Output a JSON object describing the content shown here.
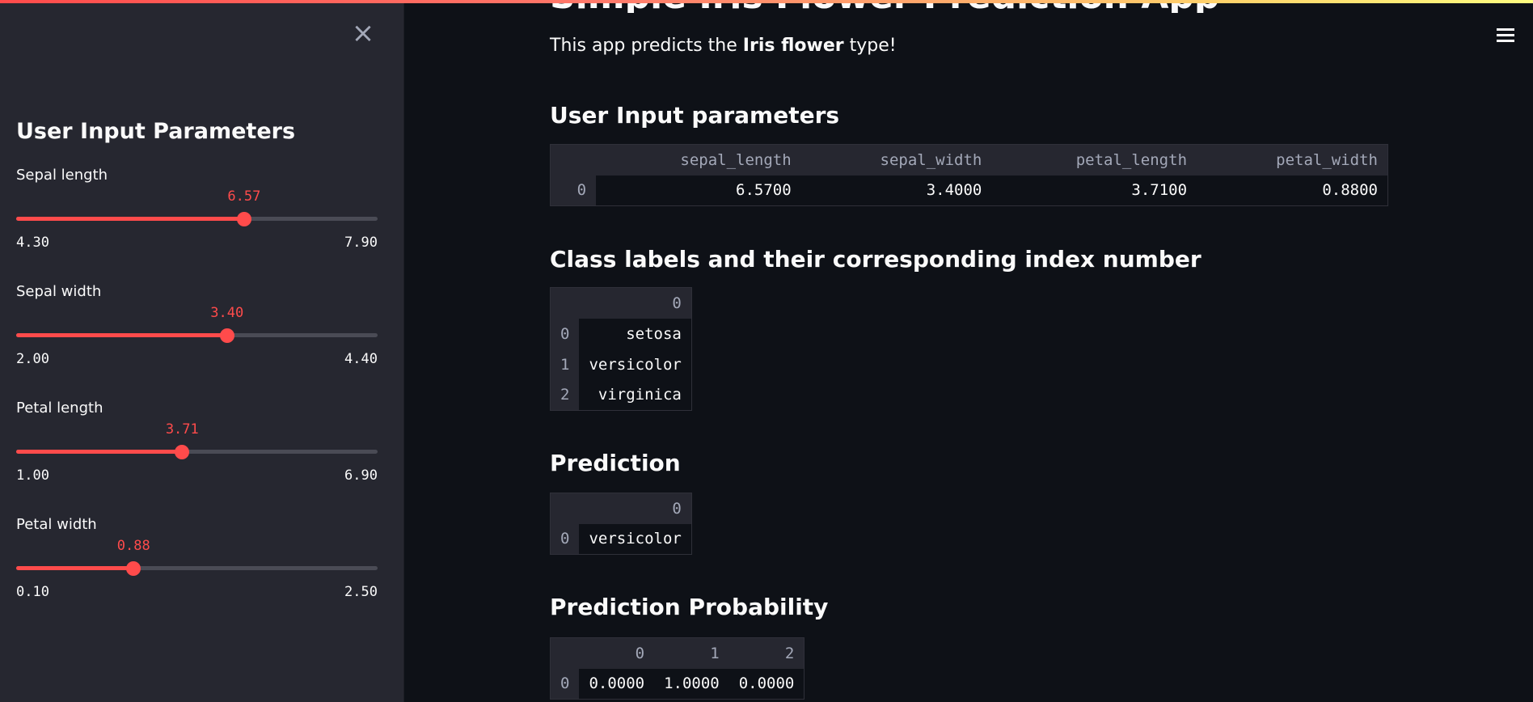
{
  "sidebar": {
    "close_icon": "×",
    "title": "User Input Parameters",
    "sliders": [
      {
        "label": "Sepal length",
        "value": "6.57",
        "min": "4.30",
        "max": "7.90",
        "fraction": 0.6306
      },
      {
        "label": "Sepal width",
        "value": "3.40",
        "min": "2.00",
        "max": "4.40",
        "fraction": 0.5833
      },
      {
        "label": "Petal length",
        "value": "3.71",
        "min": "1.00",
        "max": "6.90",
        "fraction": 0.4593
      },
      {
        "label": "Petal width",
        "value": "0.88",
        "min": "0.10",
        "max": "2.50",
        "fraction": 0.325
      }
    ]
  },
  "main": {
    "page_title": "Simple Iris Flower Prediction App",
    "intro": {
      "pre": "This app predicts the ",
      "bold": "Iris flower",
      "post": " type!"
    },
    "sections": {
      "user_input": {
        "heading": "User Input parameters",
        "columns": [
          "",
          "sepal_length",
          "sepal_width",
          "petal_length",
          "petal_width"
        ],
        "rows": [
          [
            "0",
            "6.5700",
            "3.4000",
            "3.7100",
            "0.8800"
          ]
        ]
      },
      "class_labels": {
        "heading": "Class labels and their corresponding index number",
        "columns": [
          "",
          "0"
        ],
        "rows": [
          [
            "0",
            "setosa"
          ],
          [
            "1",
            "versicolor"
          ],
          [
            "2",
            "virginica"
          ]
        ]
      },
      "prediction": {
        "heading": "Prediction",
        "columns": [
          "",
          "0"
        ],
        "rows": [
          [
            "0",
            "versicolor"
          ]
        ]
      },
      "prediction_probability": {
        "heading": "Prediction Probability",
        "columns": [
          "",
          "0",
          "1",
          "2"
        ],
        "rows": [
          [
            "0",
            "0.0000",
            "1.0000",
            "0.0000"
          ]
        ]
      }
    }
  },
  "colors": {
    "accent": "#ff4b4b",
    "background": "#0e1117",
    "sidebar": "#262730"
  },
  "icons": {
    "close": "close-icon",
    "menu": "hamburger-menu-icon"
  }
}
